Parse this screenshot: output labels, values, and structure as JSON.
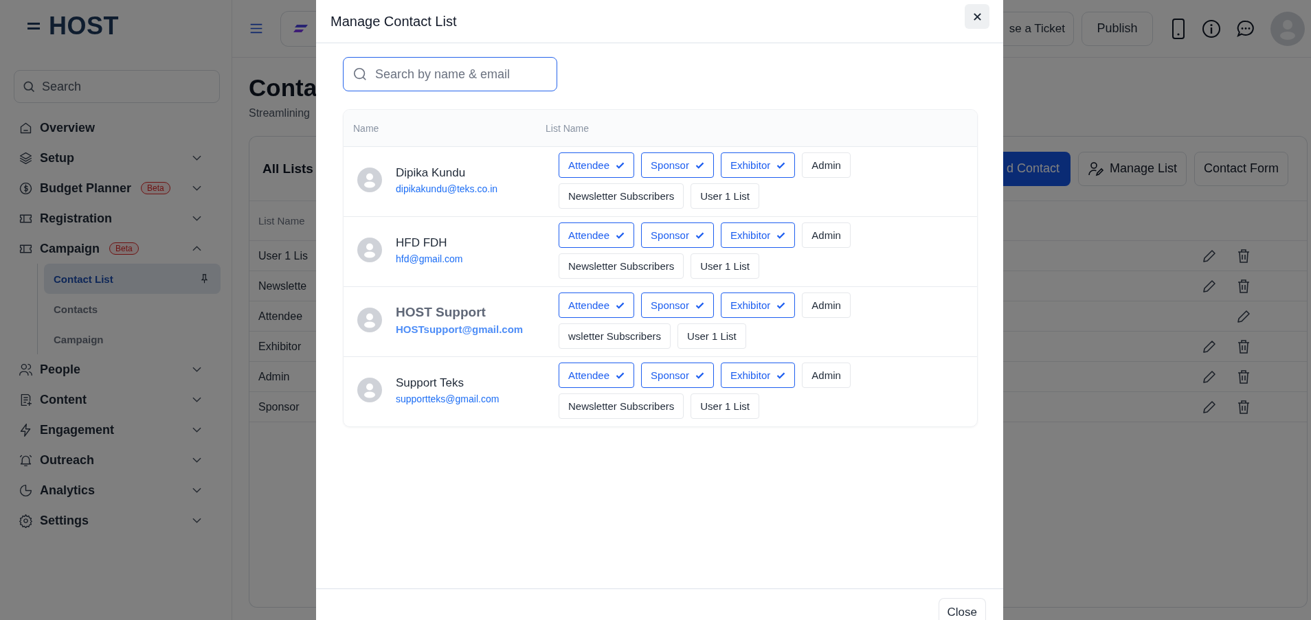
{
  "sidebar": {
    "logo": "HOST",
    "search": {
      "placeholder": "Search"
    },
    "items": [
      {
        "label": "Overview"
      },
      {
        "label": "Setup",
        "expanded": false
      },
      {
        "label": "Budget Planner",
        "badge": "Beta",
        "expanded": false
      },
      {
        "label": "Registration",
        "expanded": false
      },
      {
        "label": "Campaign",
        "badge": "Beta",
        "expanded": true,
        "children": [
          {
            "label": "Contact List",
            "selected": true
          },
          {
            "label": "Contacts",
            "selected": false
          },
          {
            "label": "Campaign",
            "selected": false
          }
        ]
      },
      {
        "label": "People",
        "expanded": false
      },
      {
        "label": "Content",
        "expanded": false
      },
      {
        "label": "Engagement",
        "expanded": false
      },
      {
        "label": "Outreach",
        "expanded": false
      },
      {
        "label": "Analytics",
        "expanded": false
      },
      {
        "label": "Settings",
        "expanded": false
      }
    ]
  },
  "header": {
    "buttons": [
      "se a Ticket",
      "Publish"
    ]
  },
  "page": {
    "title": "Conta",
    "subtitle": "Streamlining",
    "card": {
      "title": "All Lists",
      "buttons": [
        {
          "label": "d Contact",
          "kind": "primary"
        },
        {
          "label": "Manage List",
          "kind": "icon"
        },
        {
          "label": "Contact Form",
          "kind": "plain"
        }
      ],
      "table": {
        "columns": [
          "List Name"
        ],
        "rows": [
          {
            "name": "User 1 Lis",
            "deletable": true
          },
          {
            "name": "Newslette",
            "deletable": true
          },
          {
            "name": "Attendee",
            "deletable": false
          },
          {
            "name": "Exhibitor",
            "deletable": true
          },
          {
            "name": "Admin",
            "deletable": true
          },
          {
            "name": "Sponsor",
            "deletable": true
          }
        ]
      }
    }
  },
  "modal": {
    "title": "Manage Contact List",
    "search": {
      "placeholder": "Search by name & email"
    },
    "columns": [
      "Name",
      "List Name"
    ],
    "contacts": [
      {
        "name": "Dipika Kundu",
        "email": "dipikakundu@teks.co.in",
        "emphasized": false,
        "lists": [
          {
            "label": "Attendee",
            "selected": true
          },
          {
            "label": "Sponsor",
            "selected": true
          },
          {
            "label": "Exhibitor",
            "selected": true
          },
          {
            "label": "Admin",
            "selected": false
          },
          {
            "label": "Newsletter Subscribers",
            "selected": false
          },
          {
            "label": "User 1 List",
            "selected": false
          }
        ]
      },
      {
        "name": "HFD FDH",
        "email": "hfd@gmail.com",
        "emphasized": false,
        "lists": [
          {
            "label": "Attendee",
            "selected": true
          },
          {
            "label": "Sponsor",
            "selected": true
          },
          {
            "label": "Exhibitor",
            "selected": true
          },
          {
            "label": "Admin",
            "selected": false
          },
          {
            "label": "Newsletter Subscribers",
            "selected": false
          },
          {
            "label": "User 1 List",
            "selected": false
          }
        ]
      },
      {
        "name": "HOST Support",
        "email": "HOSTsupport@gmail.com",
        "emphasized": true,
        "lists": [
          {
            "label": "Attendee",
            "selected": true
          },
          {
            "label": "Sponsor",
            "selected": true
          },
          {
            "label": "Exhibitor",
            "selected": true
          },
          {
            "label": "Admin",
            "selected": false
          },
          {
            "label": "wsletter Subscribers",
            "selected": false
          },
          {
            "label": "User 1 List",
            "selected": false
          }
        ]
      },
      {
        "name": "Support Teks",
        "email": "supportteks@gmail.com",
        "emphasized": false,
        "lists": [
          {
            "label": "Attendee",
            "selected": true
          },
          {
            "label": "Sponsor",
            "selected": true
          },
          {
            "label": "Exhibitor",
            "selected": true
          },
          {
            "label": "Admin",
            "selected": false
          },
          {
            "label": "Newsletter Subscribers",
            "selected": false
          },
          {
            "label": "User 1 List",
            "selected": false
          }
        ]
      }
    ],
    "footer_button": "Close"
  }
}
